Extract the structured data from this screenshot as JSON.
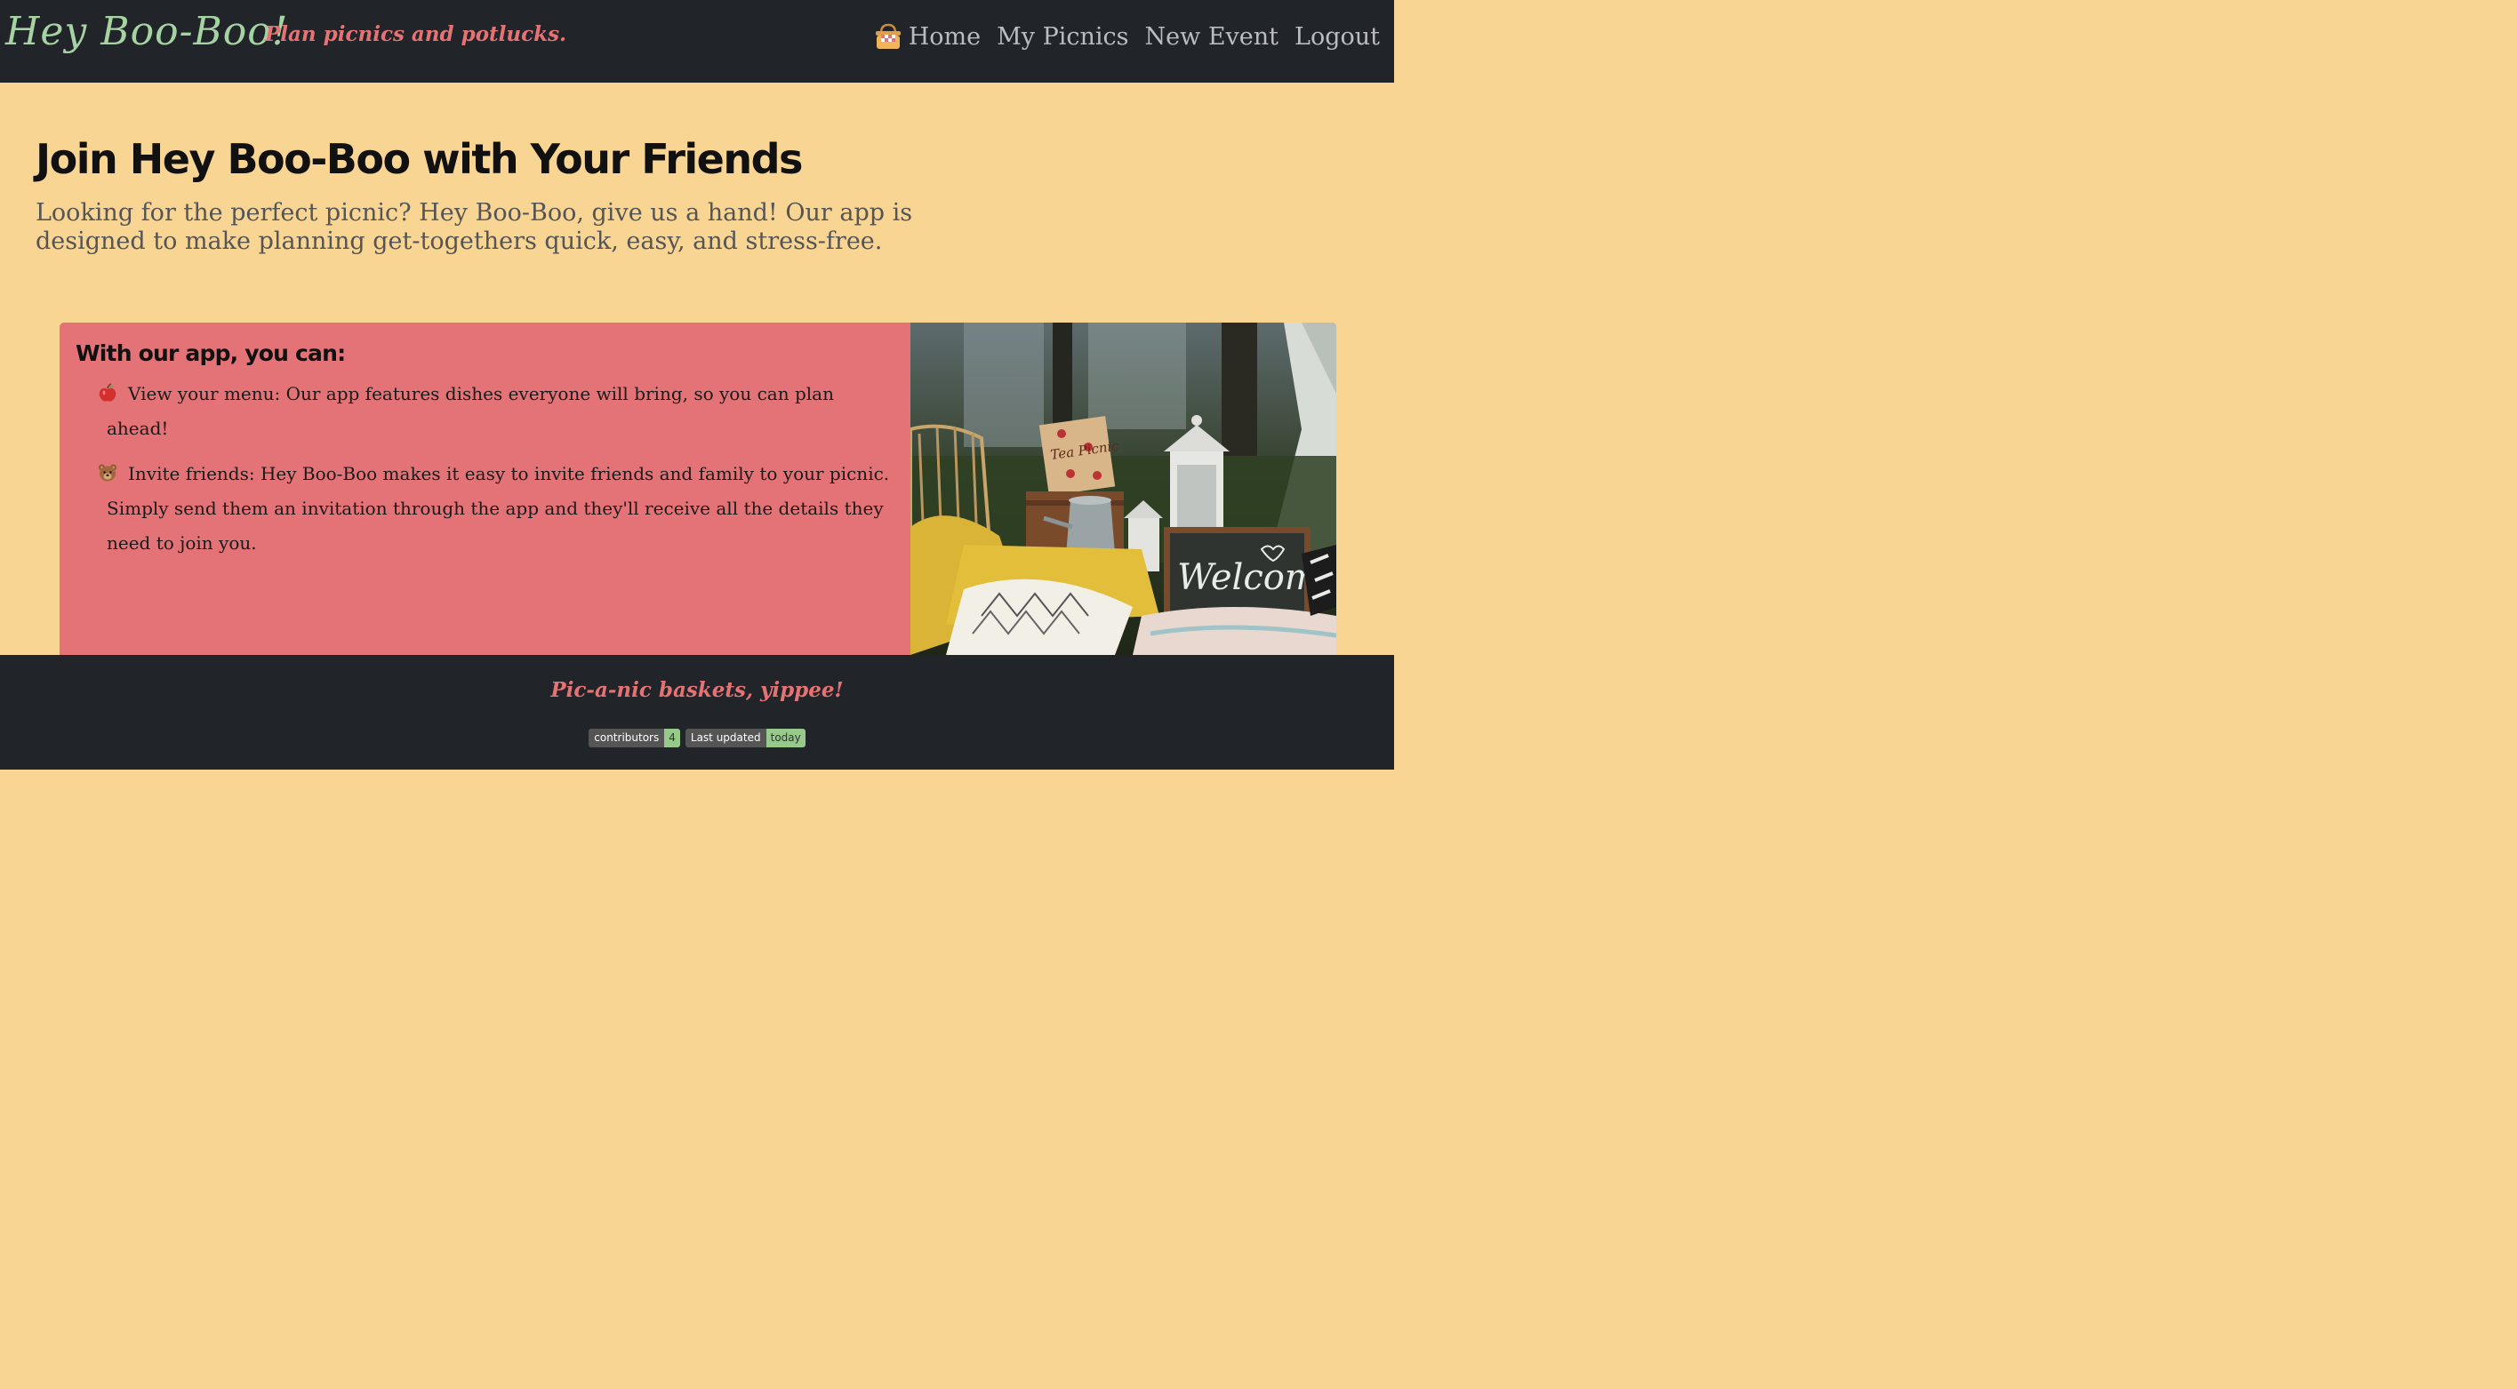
{
  "nav": {
    "brand": "Hey Boo-Boo!",
    "tagline": "Plan picnics and potlucks.",
    "basket_icon": "picnic-basket-icon",
    "links": [
      {
        "label": "Home"
      },
      {
        "label": "My Picnics"
      },
      {
        "label": "New Event"
      },
      {
        "label": "Logout"
      }
    ]
  },
  "hero": {
    "title": "Join Hey Boo-Boo with Your Friends",
    "lead": "Looking for the perfect picnic? Hey Boo-Boo, give us a hand! Our app is designed to make planning get-togethers quick, easy, and stress-free."
  },
  "card": {
    "title": "With our app, you can:",
    "features": [
      {
        "icon": "apple-icon",
        "text": "View your menu: Our app features dishes everyone will bring, so you can plan ahead!"
      },
      {
        "icon": "bear-icon",
        "text": "Invite friends: Hey Boo-Boo makes it easy to invite friends and family to your picnic. Simply send them an invitation through the app and they'll receive all the details they need to join you."
      }
    ],
    "image": {
      "sign_text": "Welcome",
      "box_text": "Tea Picnic"
    }
  },
  "footer": {
    "text": "Pic-a-nic baskets, yippee!",
    "badges": [
      {
        "label": "contributors",
        "value": "4"
      },
      {
        "label": "Last updated",
        "value": "today"
      }
    ]
  },
  "colors": {
    "navbar": "#212429",
    "brand": "#a6d3a2",
    "accent": "#e57373",
    "page_bg": "#f9d594",
    "card_bg": "#e37377"
  }
}
